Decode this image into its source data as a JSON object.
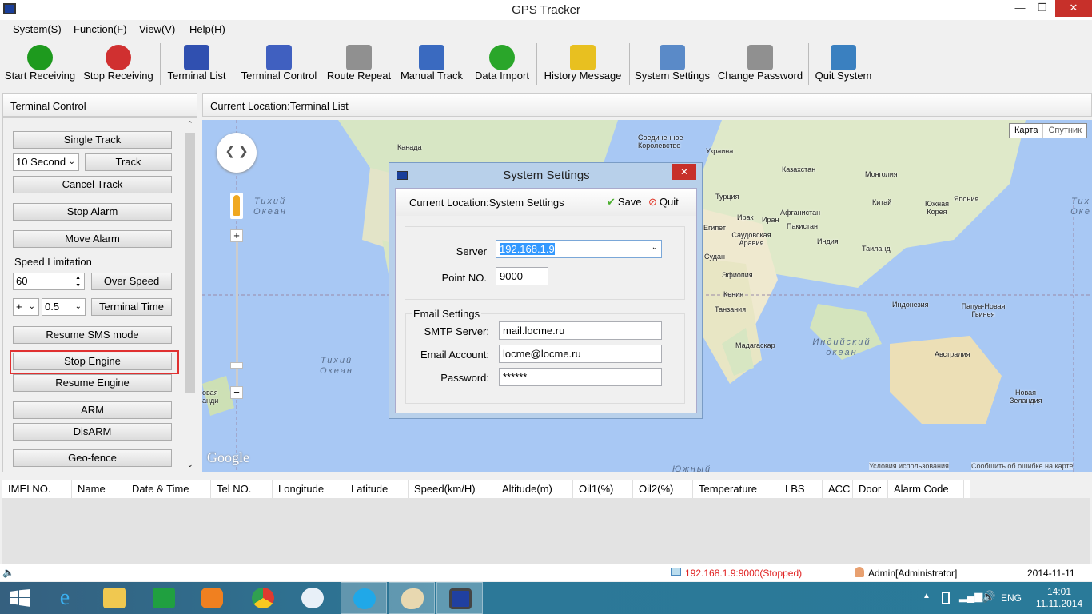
{
  "window": {
    "title": "GPS Tracker"
  },
  "menu": [
    "System(S)",
    "Function(F)",
    "View(V)",
    "Help(H)"
  ],
  "toolbar": [
    {
      "label": "Start Receiving",
      "icon": "play-icon",
      "color": "#1e9a1e"
    },
    {
      "label": "Stop Receiving",
      "icon": "stop-x-icon",
      "color": "#d03030"
    },
    {
      "label": "Terminal List",
      "icon": "tablet-icon",
      "color": "#3050b0"
    },
    {
      "label": "Terminal Control",
      "icon": "monitor-icon",
      "color": "#4060c0"
    },
    {
      "label": "Route Repeat",
      "icon": "route-play-icon",
      "color": "#909090"
    },
    {
      "label": "Manual Track",
      "icon": "hand-touch-icon",
      "color": "#3a6ac0"
    },
    {
      "label": "Data Import",
      "icon": "radar-icon",
      "color": "#2aa62a"
    },
    {
      "label": "History Message",
      "icon": "warning-doc-icon",
      "color": "#e8c020"
    },
    {
      "label": "System Settings",
      "icon": "gears-icon",
      "color": "#5a8ac8"
    },
    {
      "label": "Change Password",
      "icon": "key-icon",
      "color": "#909090"
    },
    {
      "label": "Quit System",
      "icon": "exit-door-icon",
      "color": "#3a80c0"
    }
  ],
  "left_panel": {
    "title": "Terminal Control",
    "single_track": "Single Track",
    "interval": "10 Second",
    "track": "Track",
    "cancel_track": "Cancel Track",
    "stop_alarm": "Stop Alarm",
    "move_alarm": "Move Alarm",
    "speed_limitation": "Speed Limitation",
    "speed_value": "60",
    "over_speed": "Over Speed",
    "sign": "+",
    "offset": "0.5",
    "terminal_time": "Terminal Time",
    "resume_sms": "Resume SMS mode",
    "stop_engine": "Stop Engine",
    "resume_engine": "Resume Engine",
    "arm": "ARM",
    "disarm": "DisARM",
    "geofence": "Geo-fence"
  },
  "map_panel": {
    "title": "Current Location:Terminal List",
    "map_types": [
      "Карта",
      "Спутник"
    ],
    "labels": {
      "canada": "Канада",
      "usa": "Соединенное Королевство",
      "ukraine": "Украина",
      "kazakhstan": "Казахстан",
      "mongolia": "Монголия",
      "turkey": "Турция",
      "china": "Китай",
      "skorea": "Южная Корея",
      "japan": "Япония",
      "iraq": "Ирак",
      "iran": "Иран",
      "afghanistan": "Афганистан",
      "egypt": "Египет",
      "saudi": "Саудовская Аравия",
      "pakistan": "Пакистан",
      "india": "Индия",
      "thailand": "Таиланд",
      "sudan": "Судан",
      "ethiopia": "Эфиопия",
      "kenya": "Кения",
      "tanzania": "Танзания",
      "indonesia": "Индонезия",
      "png": "Папуа-Новая Гвинея",
      "madagascar": "Мадагаскар",
      "australia": "Австралия",
      "nz_left": "овая андия",
      "nz": "Новая Зеландия",
      "pacific1": "Тихий Океан",
      "pacific2": "Тихий Океан",
      "pacific3": "Тих Оке",
      "indian": "Индийский океан",
      "south": "Южный"
    },
    "google": "Google",
    "terms": "Условия использования",
    "report": "Сообщить об ошибке на карте"
  },
  "dialog": {
    "title": "System Settings",
    "location": "Current Location:System Settings",
    "save": "Save",
    "quit": "Quit",
    "server_label": "Server",
    "server": "192.168.1.9",
    "point_label": "Point NO.",
    "point": "9000",
    "email_group": "Email Settings",
    "smtp_label": "SMTP Server:",
    "smtp": "mail.locme.ru",
    "account_label": "Email Account:",
    "account": "locme@locme.ru",
    "password_label": "Password:",
    "password": "******"
  },
  "table": {
    "columns": [
      "IMEI NO.",
      "Name",
      "Date & Time",
      "Tel NO.",
      "Longitude",
      "Latitude",
      "Speed(km/H)",
      "Altitude(m)",
      "Oil1(%)",
      "Oil2(%)",
      "Temperature",
      "LBS",
      "ACC",
      "Door",
      "Alarm Code"
    ]
  },
  "status": {
    "connection": "192.168.1.9:9000(Stopped)",
    "connection_color": "#e02020",
    "user": "Admin[Administrator]",
    "date": "2014-11-11"
  },
  "taskbar": {
    "lang": "ENG",
    "time": "14:01",
    "date": "11.11.2014"
  }
}
